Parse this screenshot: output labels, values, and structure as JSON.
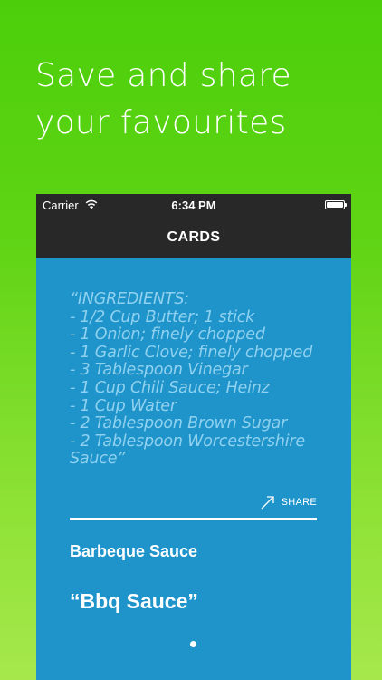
{
  "headline": "Save and share your favourites",
  "status_bar": {
    "carrier": "Carrier",
    "time": "6:34 PM"
  },
  "nav_bar": {
    "title": "CARDS"
  },
  "card": {
    "recipe_text": "“INGREDIENTS:\n- 1/2 Cup Butter; 1 stick\n- 1 Onion; finely chopped\n- 1 Garlic Clove; finely chopped\n- 3 Tablespoon Vinegar\n- 1 Cup Chili Sauce; Heinz\n- 1 Cup Water\n- 2 Tablespoon Brown Sugar\n- 2 Tablespoon Worcestershire Sauce”",
    "share_label": "SHARE",
    "title": "Barbeque Sauce",
    "name": "“Bbq Sauce”"
  },
  "icons": {
    "wifi": "wifi-icon",
    "battery": "battery-icon",
    "share": "share-arrow-icon"
  },
  "colors": {
    "background_gradient_top": "#4ccf0a",
    "background_gradient_bottom": "#a6e84c",
    "bars": "#282828",
    "card_blue": "#1e94cb",
    "recipe_text": "#8fd1ef"
  }
}
